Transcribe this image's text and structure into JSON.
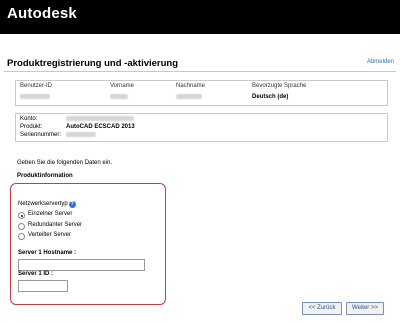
{
  "header": {
    "brand": "Autodesk"
  },
  "page": {
    "title": "Produktregistrierung und -aktivierung",
    "logout": "Abmelden"
  },
  "user_table": {
    "headers": [
      "Benutzer-ID",
      "Vorname",
      "Nachname",
      "Bevorzugte Sprache"
    ],
    "language": "Deutsch (de)"
  },
  "product_table": {
    "account_label": "Konto:",
    "product_label": "Produkt:",
    "product_value": "AutoCAD ECSCAD 2013",
    "serial_label": "Seriennummer:"
  },
  "form": {
    "instruction": "Geben Sie die folgenden Daten ein.",
    "section_title": "Produktinformation",
    "network_type_label": "Netzwerkservertyp",
    "help_glyph": "?",
    "options": [
      "Einzelner Server",
      "Redundanter Server",
      "Verteilter Server"
    ],
    "selected_option": "Einzelner Server",
    "host_label": "Server 1 Hostname :",
    "host_value": "",
    "id_label": "Server 1 ID :",
    "id_value": ""
  },
  "buttons": {
    "back": "<< Zurück",
    "next": "Weiter >>"
  },
  "colors": {
    "topbar": "#000000",
    "panel_border": "#c7384a",
    "link": "#2f6fb5"
  }
}
